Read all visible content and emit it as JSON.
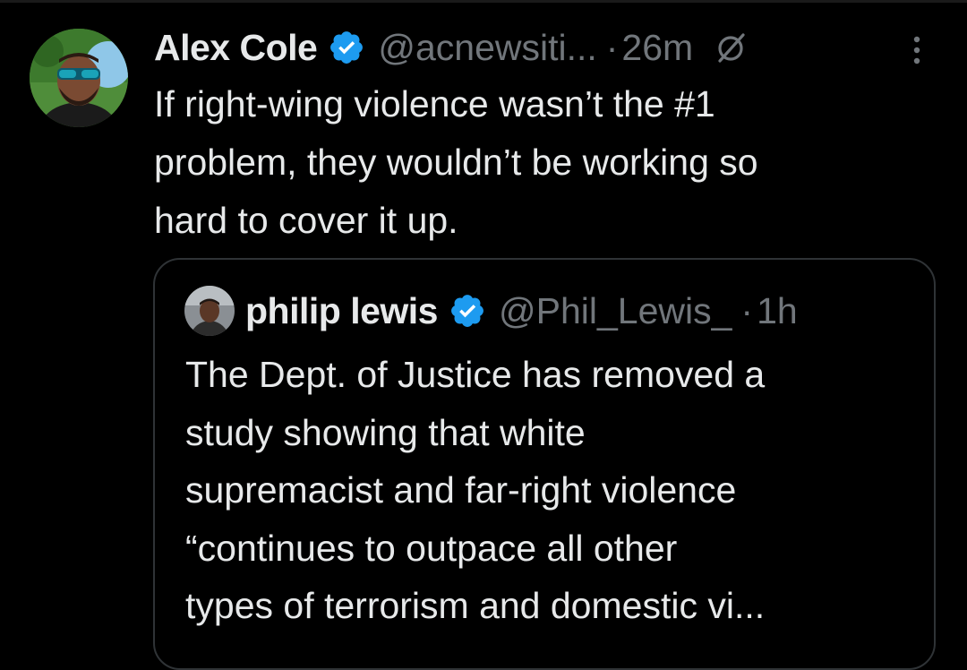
{
  "colors": {
    "background": "#000000",
    "text_primary": "#e7e9ea",
    "text_secondary": "#71767b",
    "verified_blue": "#1d9bf0",
    "card_border": "#2f3336"
  },
  "post": {
    "author_name": "Alex Cole",
    "handle": "@acnewsiti...",
    "separator": "·",
    "timestamp": "26m",
    "verified_icon": "verified-badge-icon",
    "edit_icon": "edited-icon",
    "more_icon": "more-options-icon",
    "text": "If right-wing violence wasn’t the #1\nproblem, they wouldn’t be working so\nhard to cover it up."
  },
  "quoted_post": {
    "author_name": "philip lewis",
    "handle": "@Phil_Lewis_",
    "separator": "·",
    "timestamp": "1h",
    "verified_icon": "verified-badge-icon",
    "text": "The Dept. of Justice has removed a\nstudy showing that white\nsupremacist and far-right violence\n“continues to outpace all other\ntypes of terrorism and domestic vi..."
  }
}
